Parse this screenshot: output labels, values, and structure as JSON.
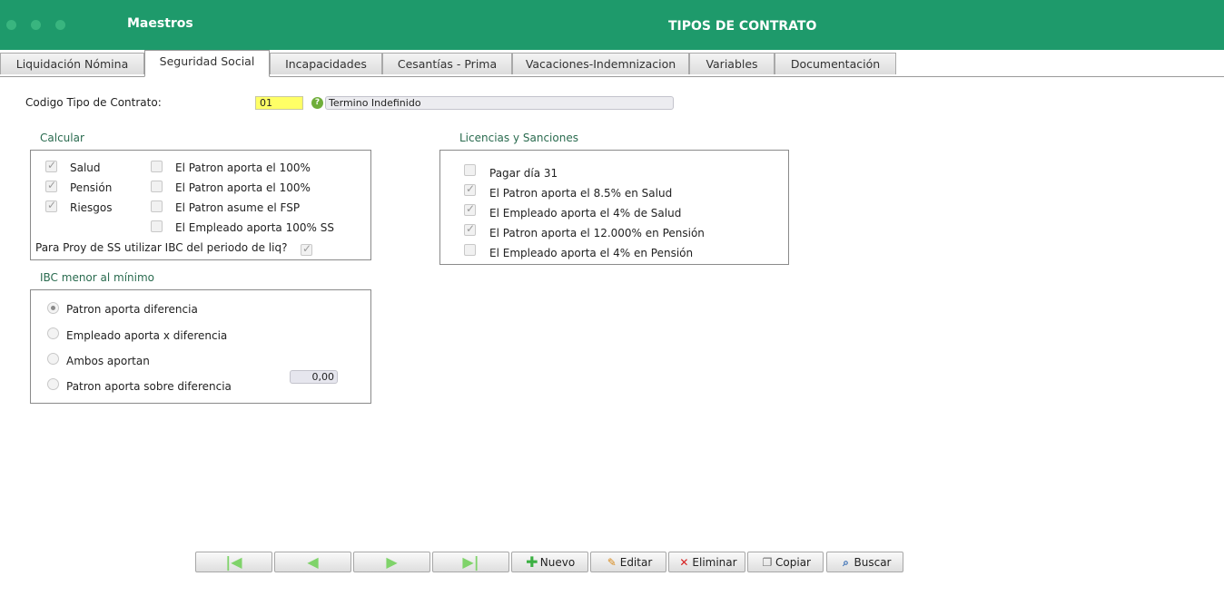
{
  "header": {
    "app_title": "Maestros",
    "page_title": "TIPOS DE CONTRATO"
  },
  "tabs": [
    {
      "label": "Liquidación Nómina"
    },
    {
      "label": "Seguridad Social"
    },
    {
      "label": "Incapacidades"
    },
    {
      "label": "Cesantías - Prima"
    },
    {
      "label": "Vacaciones-Indemnizacion"
    },
    {
      "label": "Variables"
    },
    {
      "label": "Documentación"
    }
  ],
  "active_tab": "Seguridad Social",
  "contract": {
    "code_label": "Codigo Tipo de Contrato:",
    "code_value": "01",
    "description": "Termino Indefinido"
  },
  "calcular": {
    "title": "Calcular",
    "left": [
      {
        "label": "Salud",
        "checked": true
      },
      {
        "label": "Pensión",
        "checked": true
      },
      {
        "label": "Riesgos",
        "checked": true
      }
    ],
    "right": [
      {
        "label": "El Patron aporta el 100%",
        "checked": false
      },
      {
        "label": "El Patron aporta el 100%",
        "checked": false
      },
      {
        "label": "El Patron asume el FSP",
        "checked": false
      },
      {
        "label": "El Empleado aporta 100% SS",
        "checked": false
      }
    ],
    "proy_label": "Para Proy de SS utilizar IBC del periodo de liq?",
    "proy_checked": true
  },
  "licencias": {
    "title": "Licencias y Sanciones",
    "items": [
      {
        "label": "Pagar día 31",
        "checked": false
      },
      {
        "label": "El Patron aporta el 8.5% en Salud",
        "checked": true
      },
      {
        "label": "El Empleado aporta el 4% de Salud",
        "checked": true
      },
      {
        "label": "El Patron aporta el 12.000% en Pensión",
        "checked": true
      },
      {
        "label": "El Empleado aporta el 4% en Pensión",
        "checked": false
      }
    ]
  },
  "ibc": {
    "title": "IBC menor al mínimo",
    "options": [
      {
        "label": "Patron aporta diferencia",
        "selected": true
      },
      {
        "label": "Empleado aporta x diferencia",
        "selected": false
      },
      {
        "label": "Ambos aportan",
        "selected": false
      },
      {
        "label": "Patron aporta sobre diferencia",
        "selected": false
      }
    ],
    "value": "0,00"
  },
  "toolbar": {
    "nuevo": "Nuevo",
    "editar": "Editar",
    "eliminar": "Eliminar",
    "copiar": "Copiar",
    "buscar": "Buscar"
  },
  "colors": {
    "header_bg": "#1e9a6b",
    "code_field_bg": "#ffff66",
    "section_title": "#2a6b4f"
  }
}
